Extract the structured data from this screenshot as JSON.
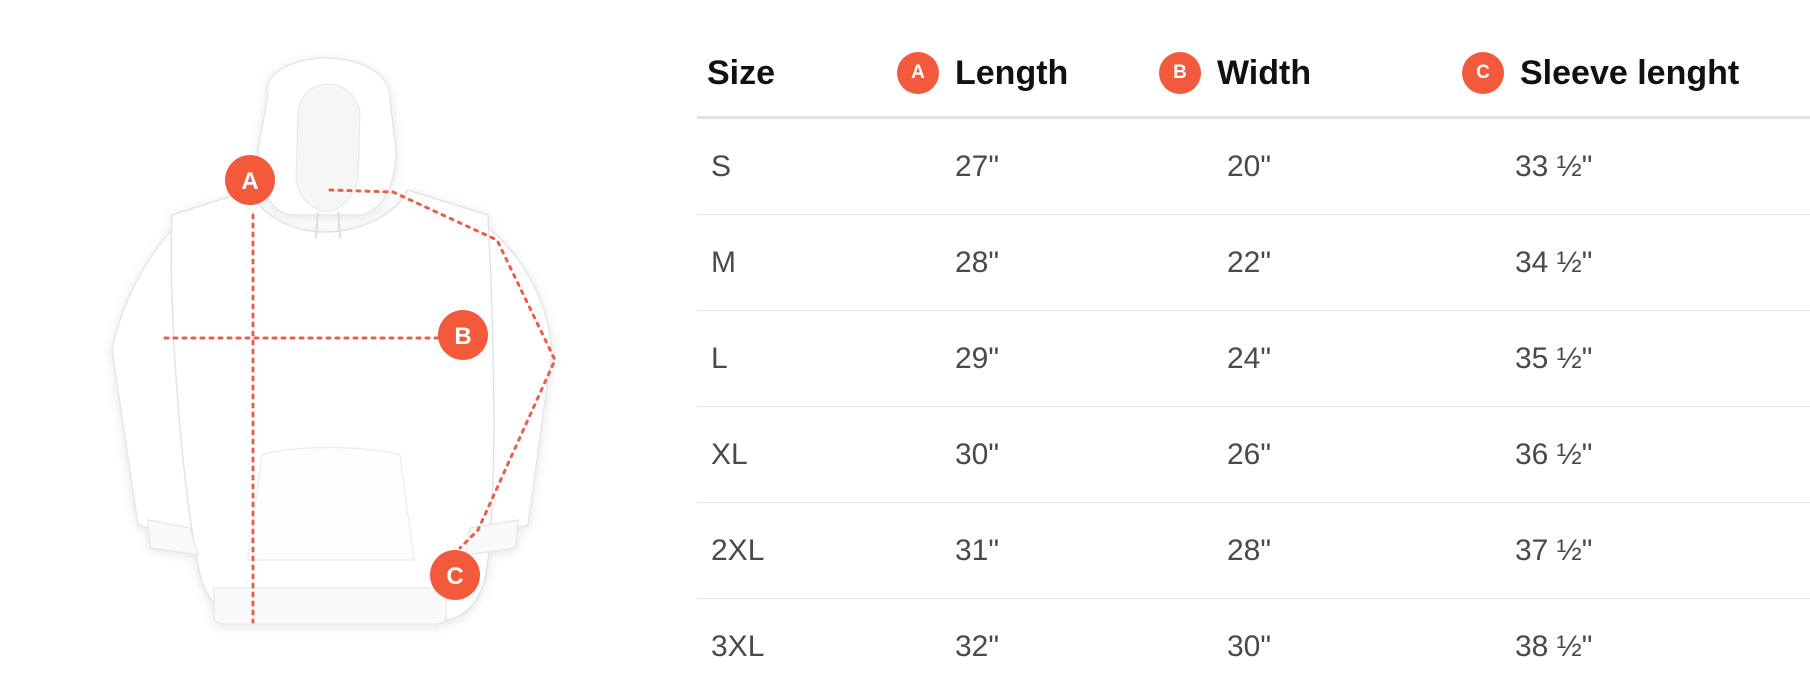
{
  "illustration": {
    "markers": {
      "a": "A",
      "b": "B",
      "c": "C"
    },
    "accent_color": "#f35a3c",
    "line_color": "#e8604a",
    "garment_color": "#ffffff"
  },
  "table": {
    "headers": {
      "size": "Size",
      "length": {
        "badge": "A",
        "label": "Length"
      },
      "width": {
        "badge": "B",
        "label": "Width"
      },
      "sleeve": {
        "badge": "C",
        "label": "Sleeve lenght"
      }
    },
    "rows": [
      {
        "size": "S",
        "length": "27\"",
        "width": "20\"",
        "sleeve": "33 ½\""
      },
      {
        "size": "M",
        "length": "28\"",
        "width": "22\"",
        "sleeve": "34 ½\""
      },
      {
        "size": "L",
        "length": "29\"",
        "width": "24\"",
        "sleeve": "35 ½\""
      },
      {
        "size": "XL",
        "length": "30\"",
        "width": "26\"",
        "sleeve": "36 ½\""
      },
      {
        "size": "2XL",
        "length": "31\"",
        "width": "28\"",
        "sleeve": "37 ½\""
      },
      {
        "size": "3XL",
        "length": "32\"",
        "width": "30\"",
        "sleeve": "38 ½\""
      }
    ]
  }
}
